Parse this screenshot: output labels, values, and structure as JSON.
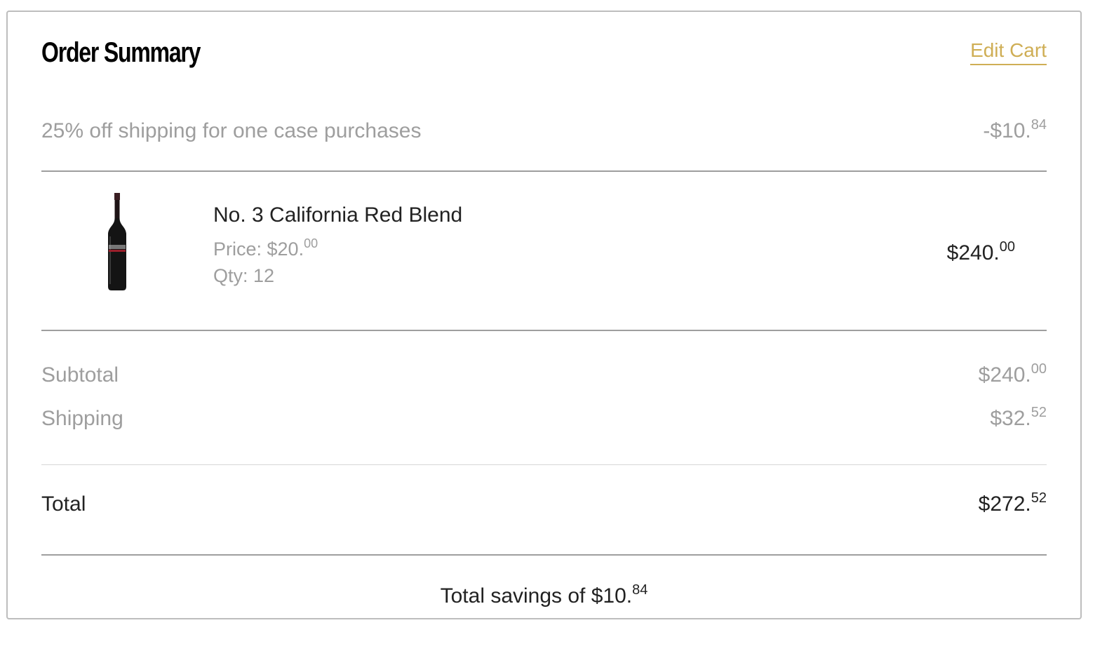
{
  "header": {
    "title": "Order Summary",
    "edit_cart_label": "Edit Cart"
  },
  "discount": {
    "label": "25% off shipping for one case purchases",
    "amount_main": "-$10.",
    "amount_cents": "84"
  },
  "product": {
    "name": "No. 3 California Red Blend",
    "price_label": "Price: $20.",
    "price_cents": "00",
    "qty_label": "Qty: 12",
    "line_total_main": "$240.",
    "line_total_cents": "00",
    "image_icon": "wine-bottle-icon"
  },
  "summary": {
    "subtotal_label": "Subtotal",
    "subtotal_main": "$240.",
    "subtotal_cents": "00",
    "shipping_label": "Shipping",
    "shipping_main": "$32.",
    "shipping_cents": "52",
    "total_label": "Total",
    "total_main": "$272.",
    "total_cents": "52"
  },
  "savings": {
    "text_main": "Total savings of $10.",
    "text_cents": "84"
  },
  "colors": {
    "accent": "#cfae55",
    "muted_text": "#9e9e9e",
    "primary_text": "#222222",
    "border": "#bdbdbd"
  }
}
